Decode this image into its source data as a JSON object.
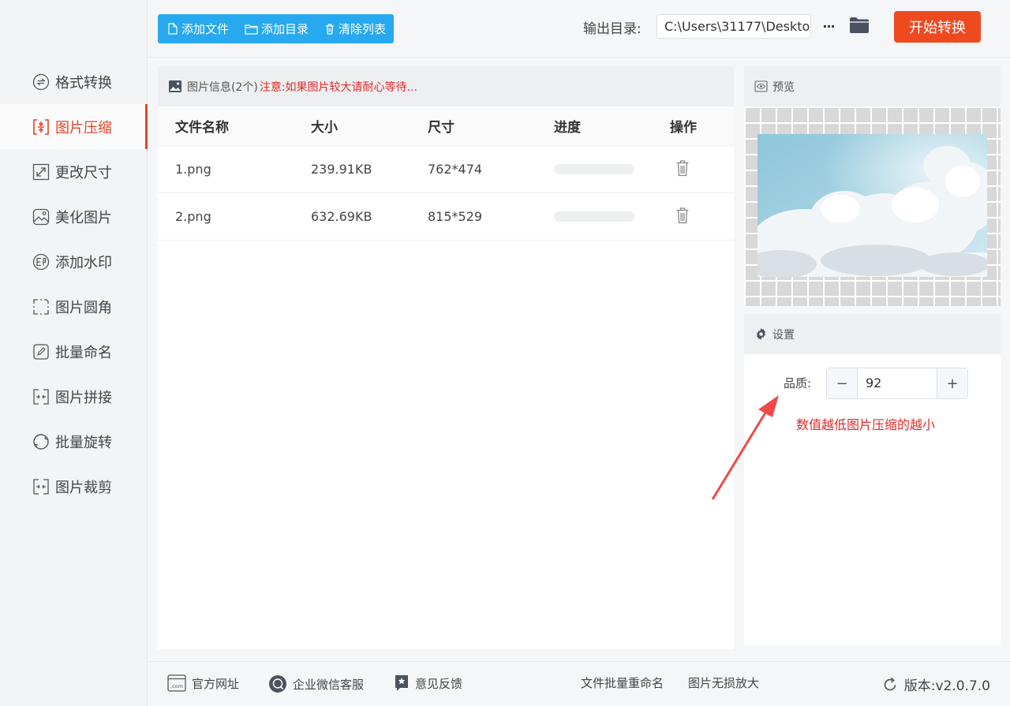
{
  "sidebar": {
    "items": [
      {
        "label": "格式转换",
        "icon": "format-convert-icon"
      },
      {
        "label": "图片压缩",
        "icon": "compress-icon",
        "active": true
      },
      {
        "label": "更改尺寸",
        "icon": "resize-icon"
      },
      {
        "label": "美化图片",
        "icon": "beautify-icon"
      },
      {
        "label": "添加水印",
        "icon": "watermark-icon"
      },
      {
        "label": "图片圆角",
        "icon": "round-corner-icon"
      },
      {
        "label": "批量命名",
        "icon": "rename-icon"
      },
      {
        "label": "图片拼接",
        "icon": "stitch-icon"
      },
      {
        "label": "批量旋转",
        "icon": "rotate-icon"
      },
      {
        "label": "图片裁剪",
        "icon": "crop-icon"
      }
    ]
  },
  "toolbar": {
    "add_file": "添加文件",
    "add_dir": "添加目录",
    "clear_list": "清除列表",
    "output_label": "输出目录:",
    "output_path": "C:\\Users\\31177\\Deskto",
    "more": "···",
    "start": "开始转换"
  },
  "files": {
    "header": "图片信息(2个)",
    "notice": "注意:如果图片较大请耐心等待...",
    "columns": [
      "文件名称",
      "大小",
      "尺寸",
      "进度",
      "操作"
    ],
    "rows": [
      {
        "name": "1.png",
        "size": "239.91KB",
        "dims": "762*474",
        "progress": 0
      },
      {
        "name": "2.png",
        "size": "632.69KB",
        "dims": "815*529",
        "progress": 0
      }
    ]
  },
  "preview": {
    "title": "预览"
  },
  "settings": {
    "title": "设置",
    "quality_label": "品质:",
    "quality_value": "92",
    "minus": "−",
    "plus": "+",
    "note": "数值越低图片压缩的越小"
  },
  "footer": {
    "website": "官方网址",
    "wechat": "企业微信客服",
    "feedback": "意见反馈",
    "batch_rename": "文件批量重命名",
    "lossless": "图片无损放大",
    "version": "版本:v2.0.7.0"
  },
  "colors": {
    "accent": "#e0462b",
    "toolbar_blue": "#27a9ef",
    "start_button": "#ef4a1f",
    "warning_text": "#e02a2a"
  }
}
